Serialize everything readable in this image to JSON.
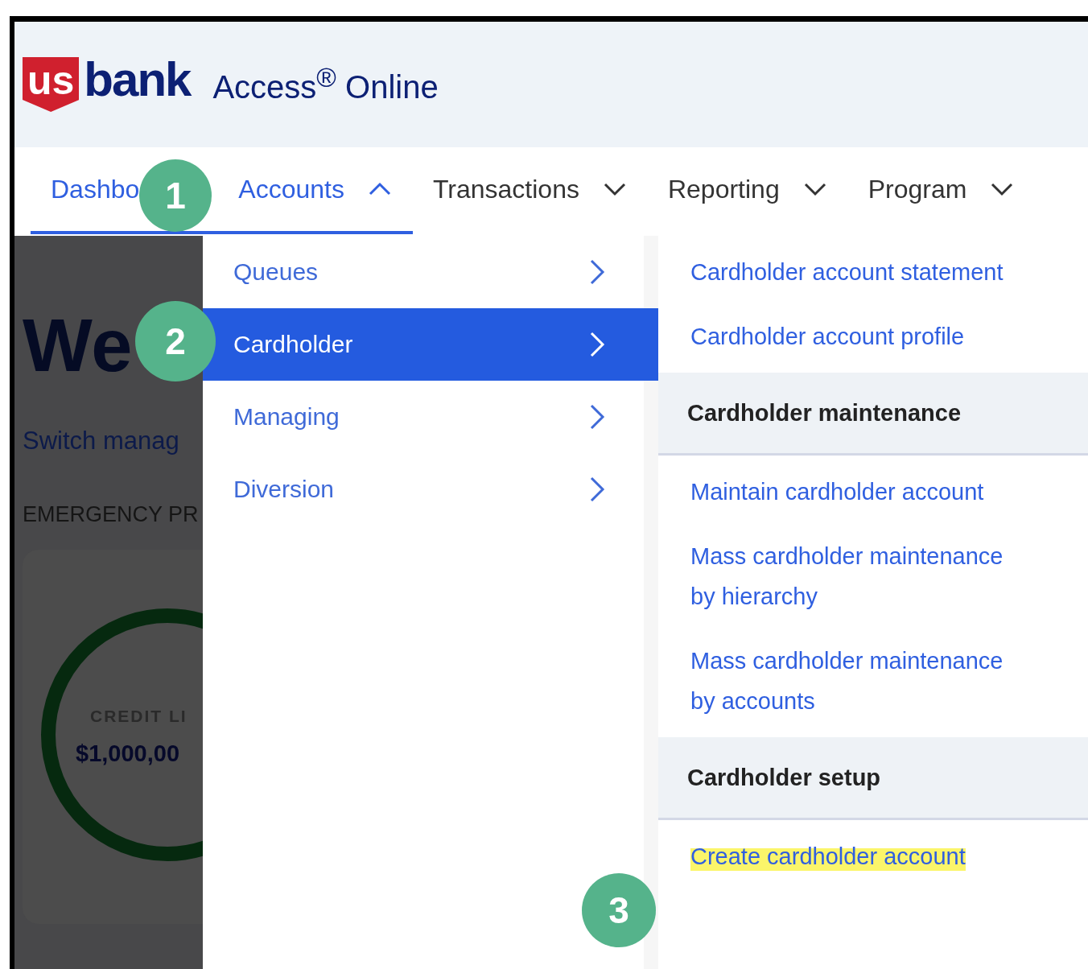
{
  "header": {
    "logo_mark": "us",
    "logo_word": "bank",
    "product": "Access$^{®}$ Online"
  },
  "nav": [
    {
      "label": "Dashbo",
      "selected": true,
      "expanded": false,
      "caret": false
    },
    {
      "label": "Accounts",
      "selected": true,
      "expanded": true,
      "caret": true
    },
    {
      "label": "Transactions",
      "selected": false,
      "expanded": false,
      "caret": true
    },
    {
      "label": "Reporting",
      "selected": false,
      "expanded": false,
      "caret": true
    },
    {
      "label": "Program",
      "selected": false,
      "expanded": false,
      "caret": true
    }
  ],
  "background_page": {
    "heading": "We",
    "link": "Switch manag",
    "section": "EMERGENCY PR",
    "card_label": "CREDIT LI",
    "card_value": "$1,000,00"
  },
  "menu": [
    {
      "label": "Queues",
      "selected": false
    },
    {
      "label": "Cardholder",
      "selected": true
    },
    {
      "label": "Managing",
      "selected": false
    },
    {
      "label": "Diversion",
      "selected": false
    }
  ],
  "submenu": [
    {
      "links": [
        {
          "label": "Cardholder account statement",
          "highlighted": false
        },
        {
          "label": "Cardholder account profile",
          "highlighted": false
        }
      ]
    },
    {
      "heading": "Cardholder maintenance",
      "links": [
        {
          "label": "Maintain cardholder account",
          "highlighted": false
        },
        {
          "label": "Mass cardholder maintenance by hierarchy",
          "highlighted": false
        },
        {
          "label": "Mass cardholder maintenance by accounts",
          "highlighted": false
        }
      ]
    },
    {
      "heading": "Cardholder setup",
      "links": [
        {
          "label": "Create cardholder account",
          "highlighted": true
        }
      ]
    }
  ],
  "step_markers": [
    "1",
    "2",
    "3"
  ]
}
